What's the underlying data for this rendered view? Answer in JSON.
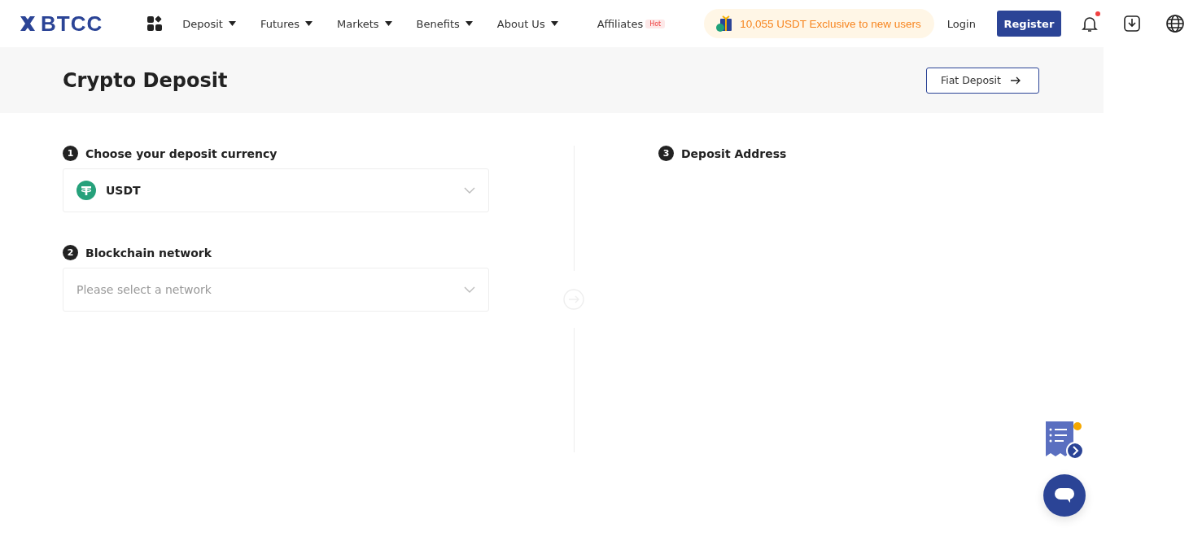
{
  "header": {
    "logo": "BTCC",
    "nav": [
      {
        "label": "Deposit",
        "kind": "dropdown"
      },
      {
        "label": "Futures",
        "kind": "dropdown"
      },
      {
        "label": "Markets",
        "kind": "dropdown"
      },
      {
        "label": "Benefits",
        "kind": "dropdown"
      },
      {
        "label": "About Us",
        "kind": "dropdown"
      },
      {
        "label": "Affiliates",
        "kind": "link",
        "badge": "Hot"
      }
    ],
    "promo": "10,055 USDT Exclusive to new users",
    "login": "Login",
    "register": "Register",
    "notification_dot": true
  },
  "banner": {
    "title": "Crypto Deposit",
    "button": "Fiat Deposit"
  },
  "steps": [
    {
      "number": "1",
      "label": "Choose your deposit currency",
      "kind": "select",
      "value": "USDT"
    },
    {
      "number": "2",
      "label": "Blockchain network",
      "kind": "select",
      "placeholder": "Please select a network"
    }
  ],
  "address_step": {
    "number": "3",
    "label": "Deposit Address"
  }
}
